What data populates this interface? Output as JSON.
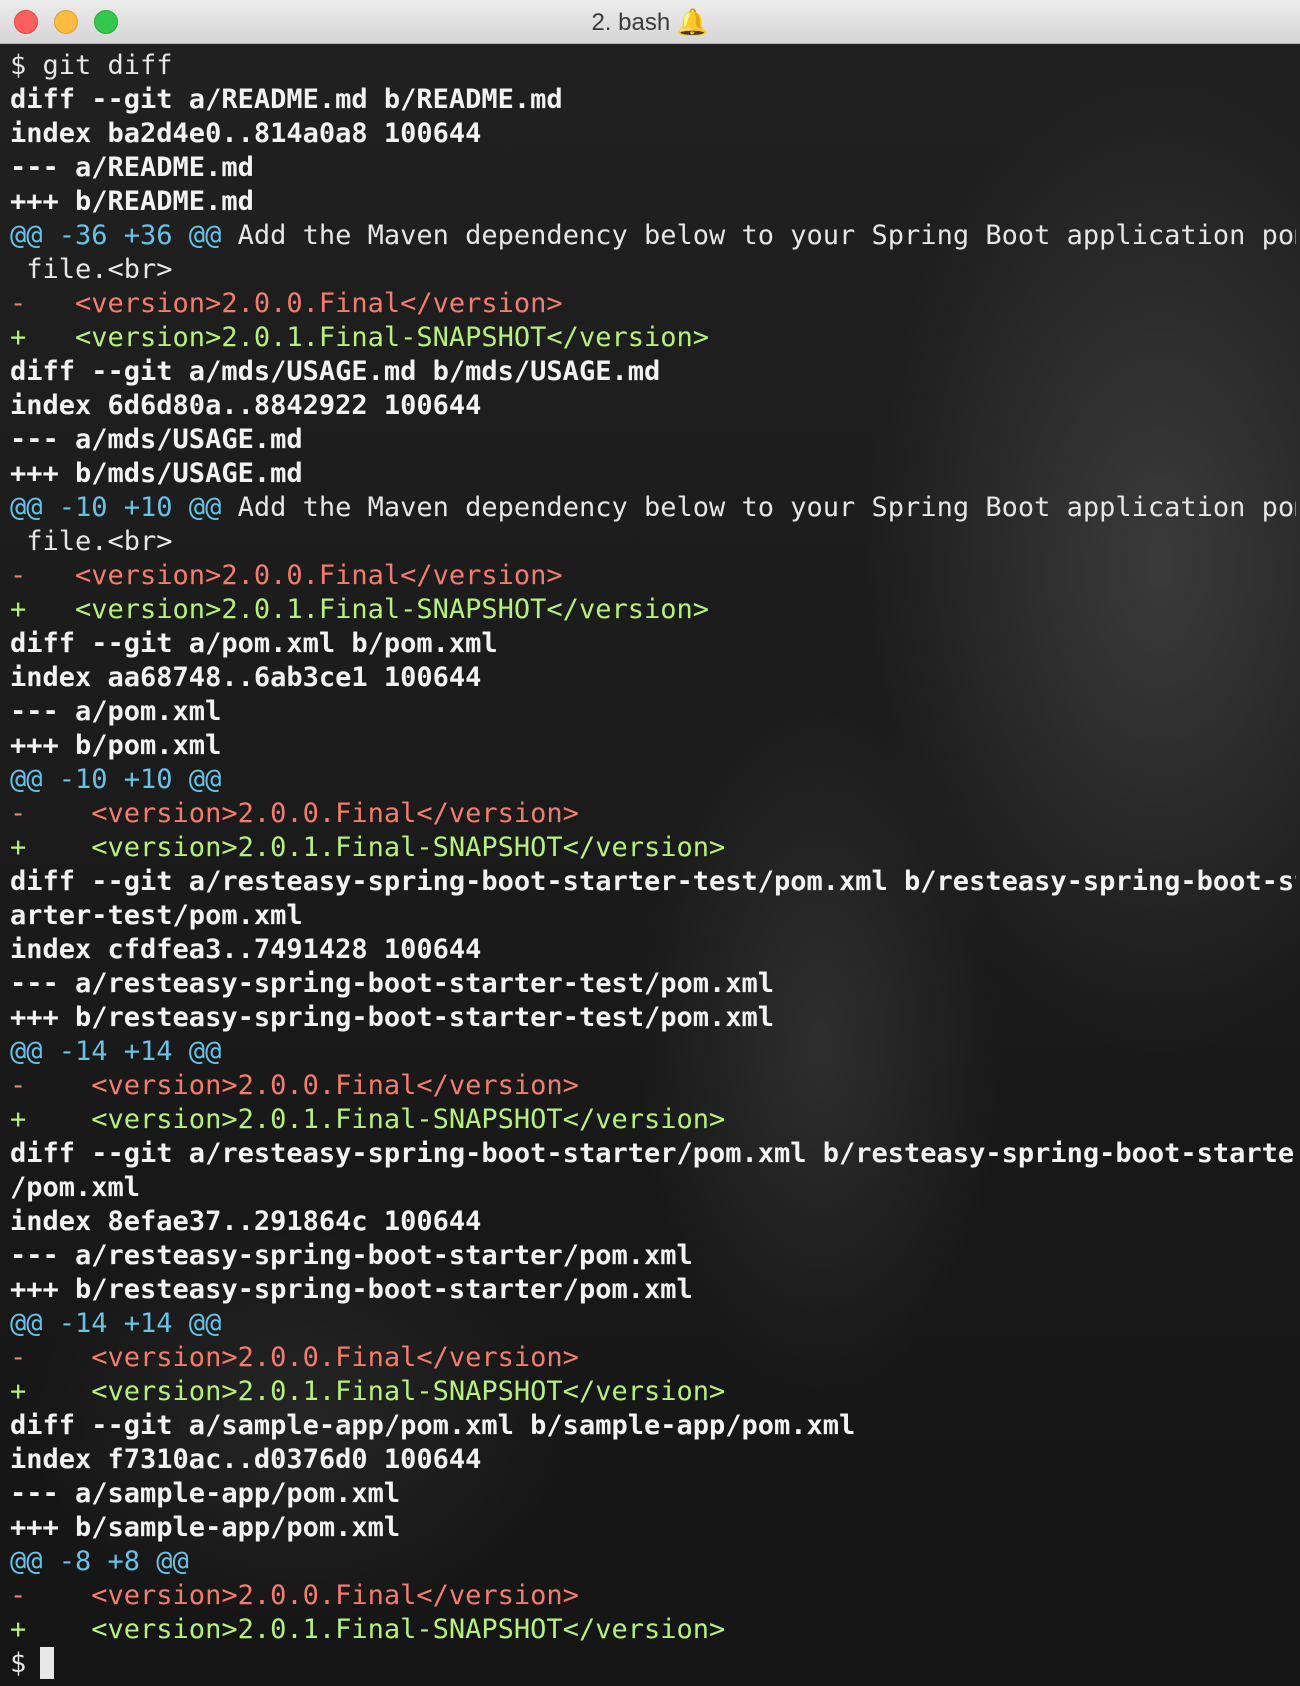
{
  "window": {
    "title": "2. bash",
    "bell_icon": "bell-icon"
  },
  "terminal": {
    "lines": [
      {
        "type": "prompt",
        "text": "$ git diff"
      },
      {
        "type": "meta",
        "text": "diff --git a/README.md b/README.md"
      },
      {
        "type": "meta",
        "text": "index ba2d4e0..814a0a8 100644"
      },
      {
        "type": "meta",
        "text": "--- a/README.md"
      },
      {
        "type": "meta",
        "text": "+++ b/README.md"
      },
      {
        "type": "hunk",
        "text": "@@ -36 +36 @@",
        "context": " Add the Maven dependency below to your Spring Boot application pom"
      },
      {
        "type": "context",
        "text": " file.<br>"
      },
      {
        "type": "del",
        "text": "-   <version>2.0.0.Final</version>"
      },
      {
        "type": "add",
        "text": "+   <version>2.0.1.Final-SNAPSHOT</version>"
      },
      {
        "type": "meta",
        "text": "diff --git a/mds/USAGE.md b/mds/USAGE.md"
      },
      {
        "type": "meta",
        "text": "index 6d6d80a..8842922 100644"
      },
      {
        "type": "meta",
        "text": "--- a/mds/USAGE.md"
      },
      {
        "type": "meta",
        "text": "+++ b/mds/USAGE.md"
      },
      {
        "type": "hunk",
        "text": "@@ -10 +10 @@",
        "context": " Add the Maven dependency below to your Spring Boot application pom"
      },
      {
        "type": "context",
        "text": " file.<br>"
      },
      {
        "type": "del",
        "text": "-   <version>2.0.0.Final</version>"
      },
      {
        "type": "add",
        "text": "+   <version>2.0.1.Final-SNAPSHOT</version>"
      },
      {
        "type": "meta",
        "text": "diff --git a/pom.xml b/pom.xml"
      },
      {
        "type": "meta",
        "text": "index aa68748..6ab3ce1 100644"
      },
      {
        "type": "meta",
        "text": "--- a/pom.xml"
      },
      {
        "type": "meta",
        "text": "+++ b/pom.xml"
      },
      {
        "type": "hunk",
        "text": "@@ -10 +10 @@",
        "context": ""
      },
      {
        "type": "del",
        "text": "-    <version>2.0.0.Final</version>"
      },
      {
        "type": "add",
        "text": "+    <version>2.0.1.Final-SNAPSHOT</version>"
      },
      {
        "type": "meta",
        "text": "diff --git a/resteasy-spring-boot-starter-test/pom.xml b/resteasy-spring-boot-st"
      },
      {
        "type": "meta",
        "text": "arter-test/pom.xml"
      },
      {
        "type": "meta",
        "text": "index cfdfea3..7491428 100644"
      },
      {
        "type": "meta",
        "text": "--- a/resteasy-spring-boot-starter-test/pom.xml"
      },
      {
        "type": "meta",
        "text": "+++ b/resteasy-spring-boot-starter-test/pom.xml"
      },
      {
        "type": "hunk",
        "text": "@@ -14 +14 @@",
        "context": ""
      },
      {
        "type": "del",
        "text": "-    <version>2.0.0.Final</version>"
      },
      {
        "type": "add",
        "text": "+    <version>2.0.1.Final-SNAPSHOT</version>"
      },
      {
        "type": "meta",
        "text": "diff --git a/resteasy-spring-boot-starter/pom.xml b/resteasy-spring-boot-starter"
      },
      {
        "type": "meta",
        "text": "/pom.xml"
      },
      {
        "type": "meta",
        "text": "index 8efae37..291864c 100644"
      },
      {
        "type": "meta",
        "text": "--- a/resteasy-spring-boot-starter/pom.xml"
      },
      {
        "type": "meta",
        "text": "+++ b/resteasy-spring-boot-starter/pom.xml"
      },
      {
        "type": "hunk",
        "text": "@@ -14 +14 @@",
        "context": ""
      },
      {
        "type": "del",
        "text": "-    <version>2.0.0.Final</version>"
      },
      {
        "type": "add",
        "text": "+    <version>2.0.1.Final-SNAPSHOT</version>"
      },
      {
        "type": "meta",
        "text": "diff --git a/sample-app/pom.xml b/sample-app/pom.xml"
      },
      {
        "type": "meta",
        "text": "index f7310ac..d0376d0 100644"
      },
      {
        "type": "meta",
        "text": "--- a/sample-app/pom.xml"
      },
      {
        "type": "meta",
        "text": "+++ b/sample-app/pom.xml"
      },
      {
        "type": "hunk",
        "text": "@@ -8 +8 @@",
        "context": ""
      },
      {
        "type": "del",
        "text": "-    <version>2.0.0.Final</version>"
      },
      {
        "type": "add",
        "text": "+    <version>2.0.1.Final-SNAPSHOT</version>"
      }
    ],
    "final_prompt": "$"
  },
  "colors": {
    "deleted": "#f47c6e",
    "added": "#b6f277",
    "hunk_header": "#66c3e8",
    "text": "#f2f2f2"
  }
}
